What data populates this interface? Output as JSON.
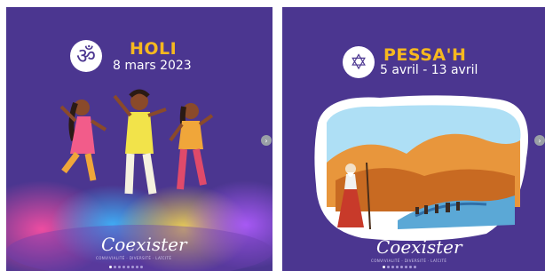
{
  "cards": [
    {
      "icon": "om-icon",
      "badge_glyph": "ॐ",
      "title": "HOLI",
      "date": "8 mars 2023",
      "logo": "Coexister",
      "tagline": "CONVIVIALITÉ · DIVERSITÉ · LAÏCITÉ"
    },
    {
      "icon": "star-of-david-icon",
      "badge_glyph": "✡",
      "title": "PESSA'H",
      "date": "5 avril - 13 avril",
      "logo": "Coexister",
      "tagline": "CONVIVIALITÉ · DIVERSITÉ · LAÏCITÉ"
    }
  ],
  "nav": {
    "next_glyph": "›"
  },
  "colors": {
    "card_bg": "#4b3690",
    "title": "#f6b81f"
  }
}
